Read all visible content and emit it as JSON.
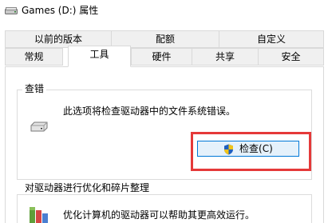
{
  "window": {
    "title": "Games (D:) 属性",
    "title_icon": "drive-icon"
  },
  "tabs": {
    "row1": [
      {
        "label": "以前的版本"
      },
      {
        "label": "配额"
      },
      {
        "label": "自定义"
      }
    ],
    "row2": [
      {
        "label": "常规"
      },
      {
        "label": "工具",
        "active": true
      },
      {
        "label": "硬件"
      },
      {
        "label": "共享"
      },
      {
        "label": "安全"
      }
    ]
  },
  "check_group": {
    "title": "查错",
    "description": "此选项将检查驱动器中的文件系统错误。",
    "button_label": "检查(C)",
    "button_icon": "uac-shield-icon",
    "icon": "hard-drive-icon"
  },
  "optimize_group": {
    "title": "对驱动器进行优化和碎片整理",
    "description": "优化计算机的驱动器可以帮助其更高效运行。",
    "icon": "defrag-icon"
  },
  "colors": {
    "highlight_box": "#e53939",
    "button_border": "#0078d7",
    "button_bg": "#e5f1fb"
  }
}
